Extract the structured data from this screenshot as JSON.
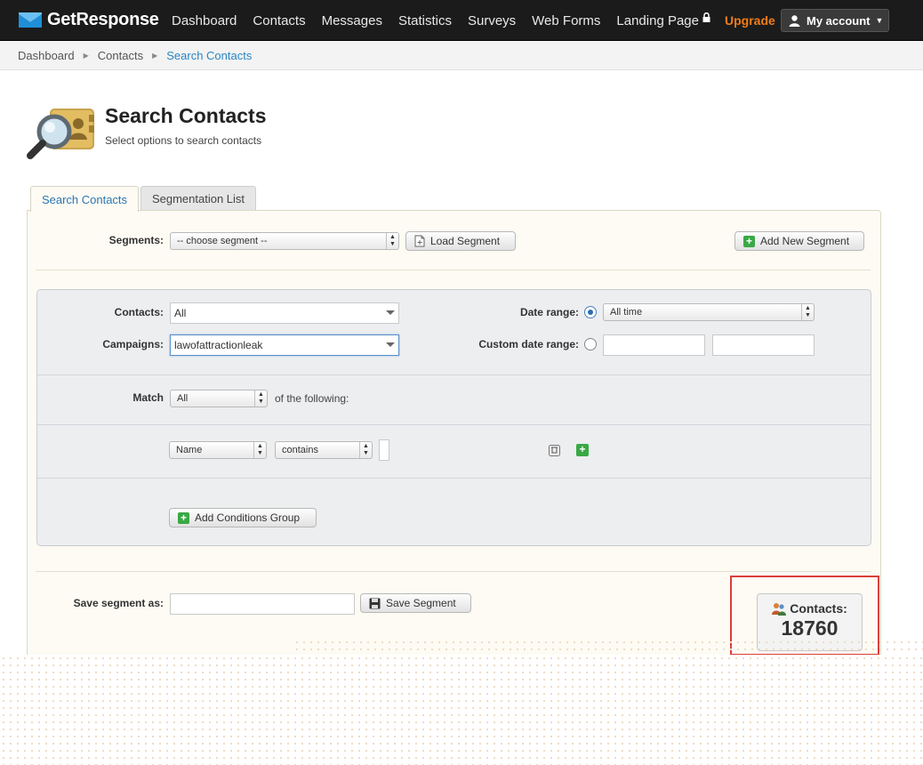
{
  "app": {
    "logo_text": "GetResponse",
    "nav": [
      "Dashboard",
      "Contacts",
      "Messages",
      "Statistics",
      "Surveys",
      "Web Forms",
      "Landing Page"
    ],
    "upgrade_label": "Upgrade",
    "account_label": "My account"
  },
  "breadcrumb": [
    "Dashboard",
    "Contacts",
    "Search Contacts"
  ],
  "header": {
    "title": "Search Contacts",
    "subtitle": "Select options to search contacts",
    "icon": "search-contacts-icon"
  },
  "tabs": [
    {
      "label": "Search Contacts",
      "active": true
    },
    {
      "label": "Segmentation List",
      "active": false
    }
  ],
  "segments": {
    "label": "Segments:",
    "selected": "-- choose segment --",
    "load_button": "Load Segment",
    "add_button": "Add New Segment"
  },
  "filters": {
    "contacts_label": "Contacts:",
    "contacts_value": "All",
    "campaigns_label": "Campaigns:",
    "campaigns_value": "lawofattractionleak",
    "date_range_label": "Date range:",
    "date_range_value": "All time",
    "custom_range_label": "Custom date range:",
    "custom_from": "",
    "custom_to": ""
  },
  "match": {
    "label": "Match",
    "selected": "All",
    "suffix": "of the following:"
  },
  "condition": {
    "field": "Name",
    "operator": "contains",
    "value": ""
  },
  "add_group_button": "Add Conditions Group",
  "save": {
    "label": "Save segment as:",
    "value": "",
    "button": "Save Segment"
  },
  "counter": {
    "label": "Contacts:",
    "value": "18760"
  },
  "colors": {
    "accent": "#2a86c4",
    "upgrade": "#f07d1a",
    "highlight_border": "#d9403a",
    "add_green": "#3aa845"
  }
}
